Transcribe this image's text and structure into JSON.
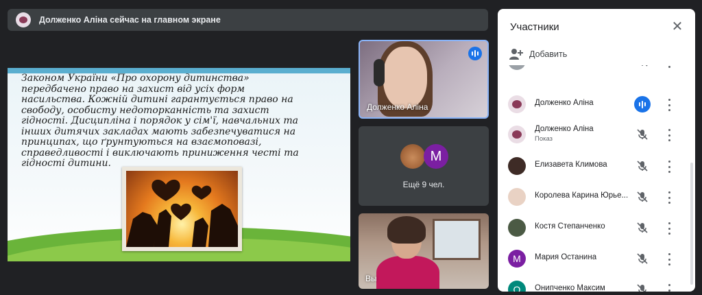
{
  "banner": {
    "text": "Долженко Аліна сейчас на главном экране"
  },
  "slide": {
    "lines": [
      "Законом України «Про охорону дитинства»",
      "передбачено право на захист від усіх форм",
      "насильства. Кожній дитині гарантується право на",
      "свободу, особисту недоторканність та захист",
      "гідності. Дисципліна і порядок у сім'ї, навчальних та",
      "інших дитячих закладах мають забезпечуватися на",
      "принципах, що ґрунтуються на взаємоповазі,",
      "справедливості і виключають приниження честі та",
      "гідності дитини."
    ]
  },
  "tiles": {
    "speaker_name": "Долженко Аліна",
    "more_avatar_letter": "M",
    "more_label": "Ещё 9 чел.",
    "you_label": "Вы"
  },
  "panel": {
    "title": "Участники",
    "add_label": "Добавить",
    "participants": [
      {
        "name": "",
        "sub": "",
        "avatar": "top",
        "letter": "",
        "mic": "muted"
      },
      {
        "name": "Долженко Аліна",
        "sub": "",
        "avatar": "alina",
        "letter": "",
        "mic": "speaking"
      },
      {
        "name": "Долженко Аліна",
        "sub": "Показ",
        "avatar": "alina",
        "letter": "",
        "mic": "muted"
      },
      {
        "name": "Елизавета Климова",
        "sub": "",
        "avatar": "lisa",
        "letter": "",
        "mic": "muted"
      },
      {
        "name": "Королева Карина Юрье...",
        "sub": "",
        "avatar": "kor",
        "letter": "",
        "mic": "muted"
      },
      {
        "name": "Костя Степанченко",
        "sub": "",
        "avatar": "kostya",
        "letter": "",
        "mic": "muted"
      },
      {
        "name": "Мария Останина",
        "sub": "",
        "avatar": "m",
        "letter": "M",
        "mic": "muted"
      },
      {
        "name": "Онипченко Максим",
        "sub": "",
        "avatar": "o",
        "letter": "O",
        "mic": "muted"
      }
    ]
  }
}
